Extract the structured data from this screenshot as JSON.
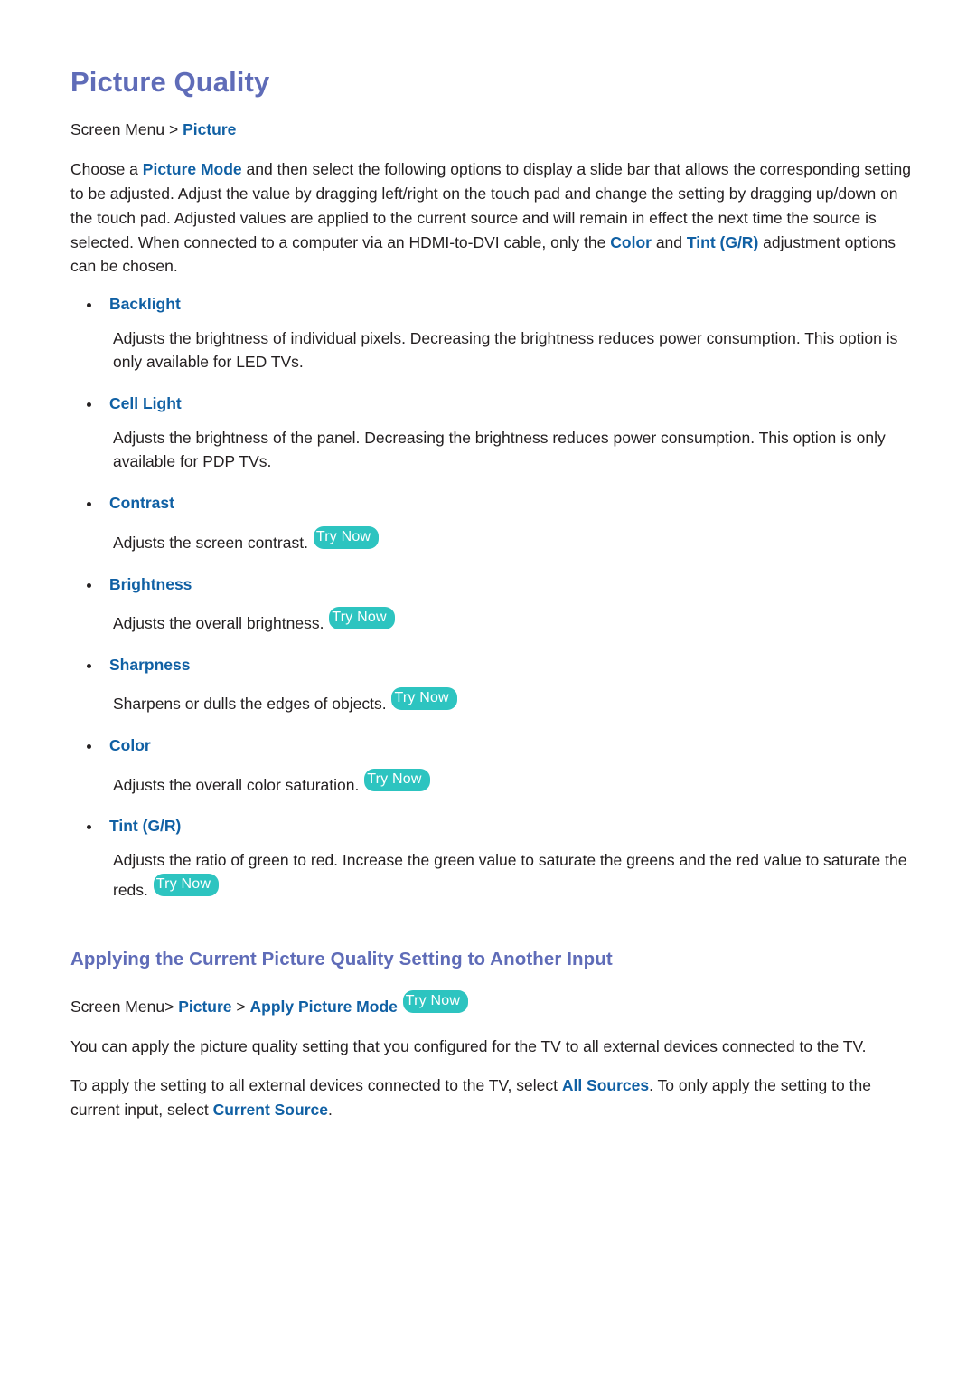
{
  "page": {
    "title": "Picture Quality",
    "breadcrumb": {
      "root": "Screen Menu",
      "separator": ">",
      "target": "Picture"
    },
    "intro": {
      "part1": "Choose a ",
      "link1": "Picture Mode",
      "part2": " and then select the following options to display a slide bar that allows the corresponding setting to be adjusted. Adjust the value by dragging left/right on the touch pad and change the setting by dragging up/down on the touch pad. Adjusted values are applied to the current source and will remain in effect the next time the source is selected. When connected to a computer via an HDMI-to-DVI cable, only the ",
      "link2": "Color",
      "part3": " and ",
      "link3": "Tint (G/R)",
      "part4": " adjustment options can be chosen."
    },
    "options": [
      {
        "name": "Backlight",
        "description": "Adjusts the brightness of individual pixels. Decreasing the brightness reduces power consumption. This option is only available for LED TVs.",
        "try_now": false,
        "try_now_label": ""
      },
      {
        "name": "Cell Light",
        "description": "Adjusts the brightness of the panel. Decreasing the brightness reduces power consumption. This option is only available for PDP TVs.",
        "try_now": false,
        "try_now_label": ""
      },
      {
        "name": "Contrast",
        "description": "Adjusts the screen contrast.",
        "try_now": true,
        "try_now_label": "Try Now"
      },
      {
        "name": "Brightness",
        "description": "Adjusts the overall brightness.",
        "try_now": true,
        "try_now_label": "Try Now"
      },
      {
        "name": "Sharpness",
        "description": "Sharpens or dulls the edges of objects.",
        "try_now": true,
        "try_now_label": "Try Now"
      },
      {
        "name": "Color",
        "description": "Adjusts the overall color saturation.",
        "try_now": true,
        "try_now_label": "Try Now"
      },
      {
        "name": "Tint (G/R)",
        "description": "Adjusts the ratio of green to red. Increase the green value to saturate the greens and the red value to saturate the reds.",
        "try_now": true,
        "try_now_label": "Try Now"
      }
    ],
    "section2": {
      "title": "Applying the Current Picture Quality Setting to Another Input",
      "breadcrumb": {
        "root": "Screen Menu",
        "sep1": ">",
        "crumb1": "Picture",
        "sep2": ">",
        "crumb2": "Apply Picture Mode",
        "try_now_label": "Try Now"
      },
      "para1": "You can apply the picture quality setting that you configured for the TV to all external devices connected to the TV.",
      "para2": {
        "part1": "To apply the setting to all external devices connected to the TV, select ",
        "link1": "All Sources",
        "part2": ". To only apply the setting to the current input, select ",
        "link2": "Current Source",
        "part3": "."
      }
    }
  },
  "colors": {
    "heading_purple": "#5f6cb8",
    "link_blue": "#1060a4",
    "badge_teal": "#2dc4c0",
    "body_text": "#231f20",
    "page_background": "#ffffff"
  }
}
